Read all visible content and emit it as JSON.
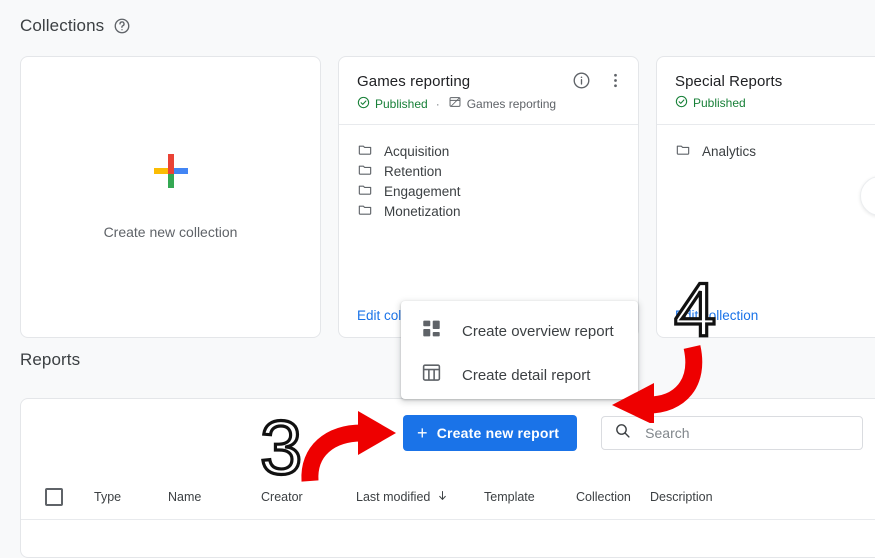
{
  "page": {
    "background": "#f8f9fa",
    "accent": "#1a73e8",
    "success": "#188038",
    "annotation_color": "#ee0000"
  },
  "collections": {
    "heading": "Collections",
    "help_icon": "help-circle-icon",
    "create_card": {
      "label": "Create new collection",
      "icon": "google-plus-icon"
    },
    "cards": [
      {
        "title": "Games reporting",
        "status": "Published",
        "status_icon": "check-circle-icon",
        "separator": "·",
        "template_icon": "template-icon",
        "template": "Games reporting",
        "info_icon": "info-icon",
        "more_icon": "more-vert-icon",
        "folders": [
          "Acquisition",
          "Retention",
          "Engagement",
          "Monetization"
        ],
        "edit_link": "Edit collection"
      },
      {
        "title": "Special Reports",
        "status": "Published",
        "status_icon": "check-circle-icon",
        "folders": [
          "Analytics"
        ],
        "edit_link": "Edit collection"
      }
    ],
    "scroll_next_icon": "chevron-right-icon"
  },
  "reports": {
    "heading": "Reports",
    "toolbar": {
      "create_button": "Create new report",
      "create_button_icon": "plus-icon",
      "search_icon": "search-icon",
      "search_placeholder": "Search",
      "search_value": ""
    },
    "table": {
      "select_all_checkbox": "select-all",
      "columns": [
        "Type",
        "Name",
        "Creator",
        "Last modified",
        "Template",
        "Collection",
        "Description"
      ],
      "sorted_column": "Last modified",
      "sort_icon": "arrow-down-icon"
    }
  },
  "menu": {
    "items": [
      {
        "label": "Create overview report",
        "icon": "overview-report-icon"
      },
      {
        "label": "Create detail report",
        "icon": "detail-report-icon"
      }
    ]
  },
  "annotations": [
    {
      "label": "3",
      "type": "hand-drawn-number"
    },
    {
      "label": "4",
      "type": "hand-drawn-number"
    },
    {
      "label": "arrow-to-create-new-report",
      "type": "red-curved-arrow"
    },
    {
      "label": "arrow-to-report-type-menu",
      "type": "red-curved-arrow"
    }
  ]
}
